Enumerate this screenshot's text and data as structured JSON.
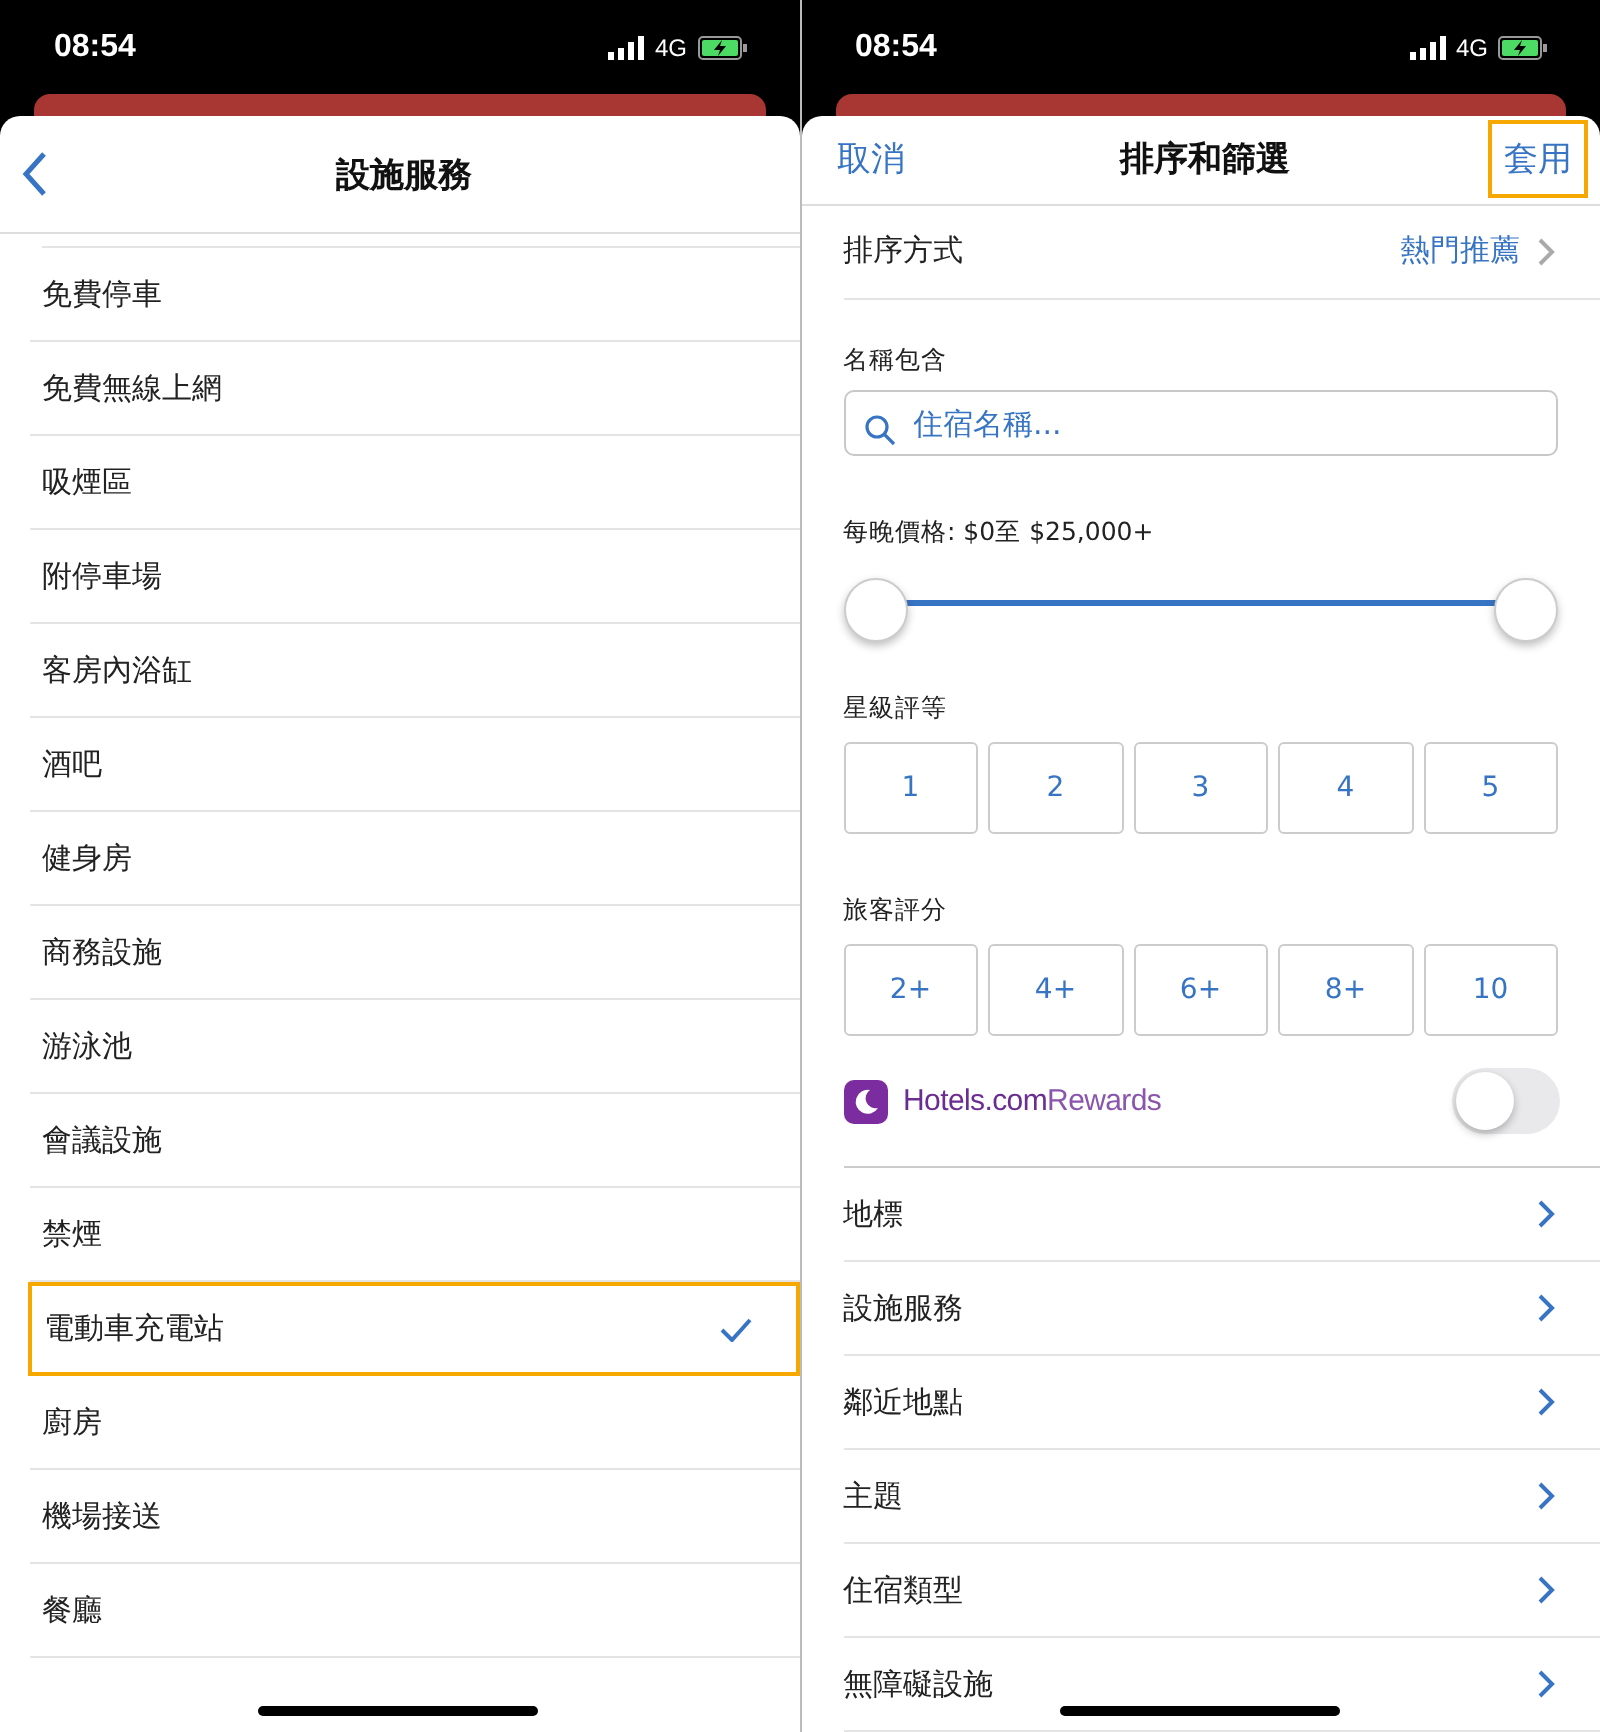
{
  "left": {
    "status_bar": {
      "time": "08:54",
      "network": "4G"
    },
    "header": {
      "title": "設施服務"
    },
    "amenities": [
      {
        "label": "免費停車",
        "checked": false,
        "highlighted": false
      },
      {
        "label": "免費無線上網",
        "checked": false,
        "highlighted": false
      },
      {
        "label": "吸煙區",
        "checked": false,
        "highlighted": false
      },
      {
        "label": "附停車場",
        "checked": false,
        "highlighted": false
      },
      {
        "label": "客房內浴缸",
        "checked": false,
        "highlighted": false
      },
      {
        "label": "酒吧",
        "checked": false,
        "highlighted": false
      },
      {
        "label": "健身房",
        "checked": false,
        "highlighted": false
      },
      {
        "label": "商務設施",
        "checked": false,
        "highlighted": false
      },
      {
        "label": "游泳池",
        "checked": false,
        "highlighted": false
      },
      {
        "label": "會議設施",
        "checked": false,
        "highlighted": false
      },
      {
        "label": "禁煙",
        "checked": false,
        "highlighted": false
      },
      {
        "label": "電動車充電站",
        "checked": true,
        "highlighted": true
      },
      {
        "label": "廚房",
        "checked": false,
        "highlighted": false
      },
      {
        "label": "機場接送",
        "checked": false,
        "highlighted": false
      },
      {
        "label": "餐廳",
        "checked": false,
        "highlighted": false
      }
    ]
  },
  "right": {
    "status_bar": {
      "time": "08:54",
      "network": "4G"
    },
    "header": {
      "cancel": "取消",
      "title": "排序和篩選",
      "apply": "套用",
      "apply_highlighted": true
    },
    "sort": {
      "label": "排序方式",
      "value": "熱門推薦"
    },
    "name_filter": {
      "label": "名稱包含",
      "placeholder": "住宿名稱..."
    },
    "price": {
      "label": "每晚價格: $0至 $25,000+",
      "thumbs": [
        {
          "level": 0
        },
        {
          "level": 1
        }
      ]
    },
    "star_rating": {
      "label": "星級評等",
      "options": [
        {
          "label": "1",
          "selected": false
        },
        {
          "label": "2",
          "selected": false
        },
        {
          "label": "3",
          "selected": false
        },
        {
          "label": "4",
          "selected": false
        },
        {
          "label": "5",
          "selected": false
        }
      ]
    },
    "guest_rating": {
      "label": "旅客評分",
      "options": [
        {
          "label": "2+",
          "selected": false
        },
        {
          "label": "4+",
          "selected": false
        },
        {
          "label": "6+",
          "selected": false
        },
        {
          "label": "8+",
          "selected": false
        },
        {
          "label": "10",
          "selected": false
        }
      ]
    },
    "rewards": {
      "brand": "Hotels.com",
      "suffix": "Rewards",
      "on": false
    },
    "nav_rows": [
      "地標",
      "設施服務",
      "鄰近地點",
      "主題",
      "住宿類型",
      "無障礙設施"
    ]
  }
}
